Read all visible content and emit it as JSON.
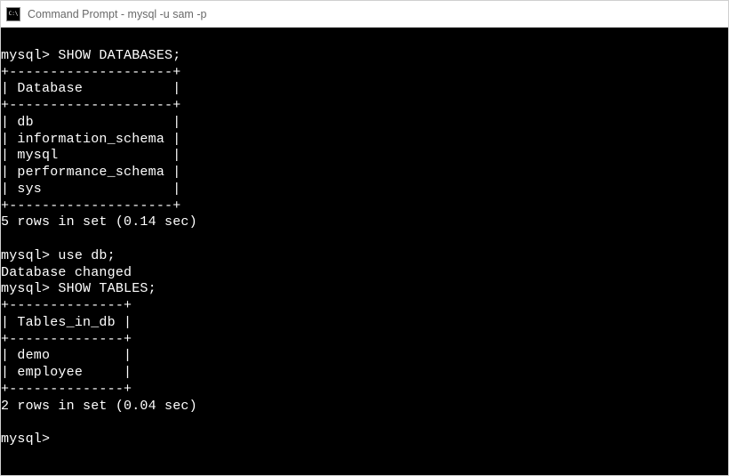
{
  "window": {
    "title": "Command Prompt - mysql  -u sam -p"
  },
  "terminal": {
    "prompt": "mysql>",
    "sessions": [
      {
        "command": "SHOW DATABASES;",
        "table": {
          "border_top": "+--------------------+",
          "header": "| Database           |",
          "border_mid": "+--------------------+",
          "rows": [
            "| db                 |",
            "| information_schema |",
            "| mysql              |",
            "| performance_schema |",
            "| sys                |"
          ],
          "border_bot": "+--------------------+"
        },
        "footer": "5 rows in set (0.14 sec)"
      },
      {
        "command": "use db;",
        "message": "Database changed"
      },
      {
        "command": "SHOW TABLES;",
        "table": {
          "border_top": "+--------------+",
          "header": "| Tables_in_db |",
          "border_mid": "+--------------+",
          "rows": [
            "| demo         |",
            "| employee     |"
          ],
          "border_bot": "+--------------+"
        },
        "footer": "2 rows in set (0.04 sec)"
      }
    ],
    "final_prompt": "mysql>"
  }
}
